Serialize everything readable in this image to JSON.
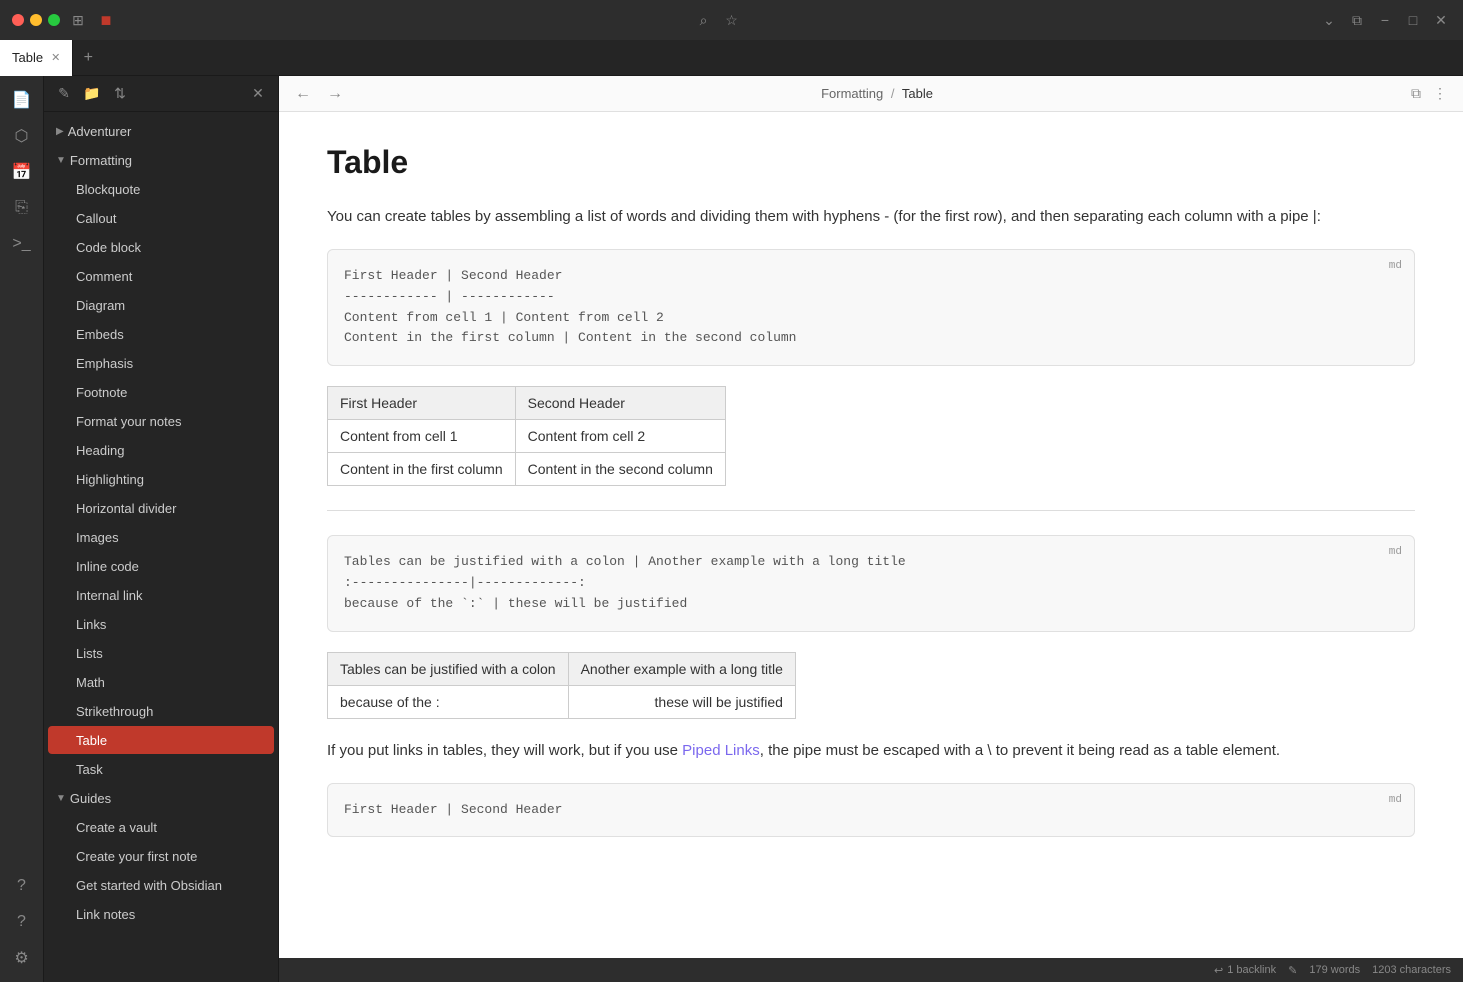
{
  "titlebar": {
    "icons": [
      "sidebar-icon",
      "red-square-icon",
      "search-icon",
      "bookmark-icon"
    ]
  },
  "tab": {
    "label": "Table",
    "active": true
  },
  "nav": {
    "breadcrumb_parent": "Formatting",
    "breadcrumb_sep": "/",
    "breadcrumb_current": "Table"
  },
  "sidebar": {
    "toolbar_icons": [
      "new-note-icon",
      "new-folder-icon",
      "sort-icon",
      "close-icon"
    ],
    "tree": [
      {
        "type": "folder",
        "label": "Adventurer",
        "expanded": false,
        "level": 0
      },
      {
        "type": "folder",
        "label": "Formatting",
        "expanded": true,
        "level": 0
      },
      {
        "type": "item",
        "label": "Blockquote",
        "level": 1
      },
      {
        "type": "item",
        "label": "Callout",
        "level": 1
      },
      {
        "type": "item",
        "label": "Code block",
        "level": 1
      },
      {
        "type": "item",
        "label": "Comment",
        "level": 1
      },
      {
        "type": "item",
        "label": "Diagram",
        "level": 1
      },
      {
        "type": "item",
        "label": "Embeds",
        "level": 1
      },
      {
        "type": "item",
        "label": "Emphasis",
        "level": 1
      },
      {
        "type": "item",
        "label": "Footnote",
        "level": 1
      },
      {
        "type": "item",
        "label": "Format your notes",
        "level": 1
      },
      {
        "type": "item",
        "label": "Heading",
        "level": 1
      },
      {
        "type": "item",
        "label": "Highlighting",
        "level": 1
      },
      {
        "type": "item",
        "label": "Horizontal divider",
        "level": 1
      },
      {
        "type": "item",
        "label": "Images",
        "level": 1
      },
      {
        "type": "item",
        "label": "Inline code",
        "level": 1
      },
      {
        "type": "item",
        "label": "Internal link",
        "level": 1
      },
      {
        "type": "item",
        "label": "Links",
        "level": 1
      },
      {
        "type": "item",
        "label": "Lists",
        "level": 1
      },
      {
        "type": "item",
        "label": "Math",
        "level": 1
      },
      {
        "type": "item",
        "label": "Strikethrough",
        "level": 1
      },
      {
        "type": "item",
        "label": "Table",
        "level": 1,
        "active": true
      },
      {
        "type": "item",
        "label": "Task",
        "level": 1
      },
      {
        "type": "folder",
        "label": "Guides",
        "expanded": true,
        "level": 0
      },
      {
        "type": "item",
        "label": "Create a vault",
        "level": 1
      },
      {
        "type": "item",
        "label": "Create your first note",
        "level": 1
      },
      {
        "type": "item",
        "label": "Get started with Obsidian",
        "level": 1
      },
      {
        "type": "item",
        "label": "Link notes",
        "level": 1
      }
    ]
  },
  "doc": {
    "title": "Table",
    "intro": "You can create tables by assembling a list of words and dividing them with hyphens - (for the first row), and then separating each column with a pipe |:",
    "code_block_1": "First Header | Second Header\n------------ | ------------\nContent from cell 1 | Content from cell 2\nContent in the first column | Content in the second column",
    "lang_badge_1": "md",
    "table1": {
      "headers": [
        "First Header",
        "Second Header"
      ],
      "rows": [
        [
          "Content from cell 1",
          "Content from cell 2"
        ],
        [
          "Content in the first column",
          "Content in the second column"
        ]
      ]
    },
    "code_block_2": "Tables can be justified with a colon | Another example with a long title\n:---------------|-------------:\nbecause of the `:` | these will be justified",
    "lang_badge_2": "md",
    "table2": {
      "headers": [
        "Tables can be justified with a colon",
        "Another example with a long title"
      ],
      "rows": [
        [
          "because of the  :",
          "these will be justified"
        ]
      ]
    },
    "para2_pre": "If you put links in tables, they will work, but if you use ",
    "para2_link": "Piped Links",
    "para2_post": ", the pipe must be escaped with a \\ to prevent it being read as a table element.",
    "code_block_3_start": "First Header | Second Header"
  },
  "status": {
    "backlinks": "1 backlink",
    "words": "179 words",
    "chars": "1203 characters"
  }
}
